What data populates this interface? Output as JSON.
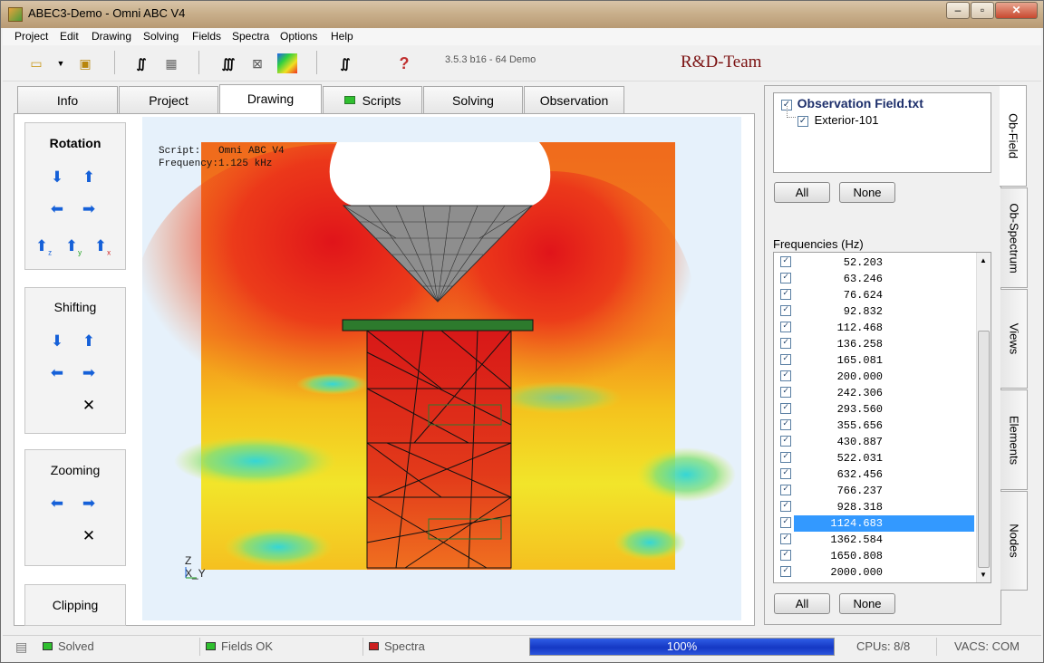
{
  "window": {
    "title": "ABEC3-Demo - Omni ABC V4"
  },
  "menu": [
    "Project",
    "Edit",
    "Drawing",
    "Solving",
    "Fields",
    "Spectra",
    "Options",
    "Help"
  ],
  "toolbar": {
    "version": "3.5.3 b16 - 64 Demo",
    "team": "R&D-Team",
    "help_glyph": "?"
  },
  "tabs": [
    "Info",
    "Project",
    "Drawing",
    "Scripts",
    "Solving",
    "Observation"
  ],
  "active_tab": "Drawing",
  "left_controls": {
    "rotation": "Rotation",
    "shifting": "Shifting",
    "zooming": "Zooming",
    "clipping": "Clipping"
  },
  "drawing": {
    "script_label": "Script:",
    "script_value": "Omni ABC V4",
    "frequency_label": "Frequency:",
    "frequency_value": "1.125 kHz",
    "axis_z": "Z",
    "axis_xy": "X_Y"
  },
  "side_panel": {
    "tree_root": "Observation Field.txt",
    "tree_child": "Exterior-101",
    "all_label": "All",
    "none_label": "None",
    "frequencies_label": "Frequencies  (Hz)",
    "frequencies": [
      "52.203",
      "63.246",
      "76.624",
      "92.832",
      "112.468",
      "136.258",
      "165.081",
      "200.000",
      "242.306",
      "293.560",
      "355.656",
      "430.887",
      "522.031",
      "632.456",
      "766.237",
      "928.318",
      "1124.683",
      "1362.584",
      "1650.808",
      "2000.000"
    ],
    "selected_frequency": "1124.683"
  },
  "vertical_tabs": [
    "Ob-Field",
    "Ob-Spectrum",
    "Views",
    "Elements",
    "Nodes"
  ],
  "status": {
    "solved": "Solved",
    "fields": "Fields OK",
    "spectra": "Spectra",
    "progress": "100%",
    "cpus": "CPUs: 8/8",
    "vacs": "VACS: COM"
  },
  "colors": {
    "accent": "#3399ff",
    "progress": "#1538c4",
    "team": "#7a1010",
    "ok": "#2fbf2f",
    "error": "#cc1f1f"
  }
}
